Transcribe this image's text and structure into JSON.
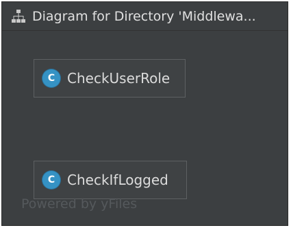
{
  "window": {
    "title": "Diagram for Directory 'Middlewa...",
    "title_icon": "diagram-hierarchy-icon"
  },
  "nodes": [
    {
      "label": "CheckUserRole",
      "kind_badge": "C",
      "icon": "class-icon"
    },
    {
      "label": "CheckIfLogged",
      "kind_badge": "C",
      "icon": "class-icon"
    }
  ],
  "watermark": "Powered by yFiles",
  "colors": {
    "background": "#3c3f41",
    "node_fill": "#3f4244",
    "node_border": "#5e6163",
    "class_badge": "#3592c4",
    "text": "#dcdcdc"
  }
}
